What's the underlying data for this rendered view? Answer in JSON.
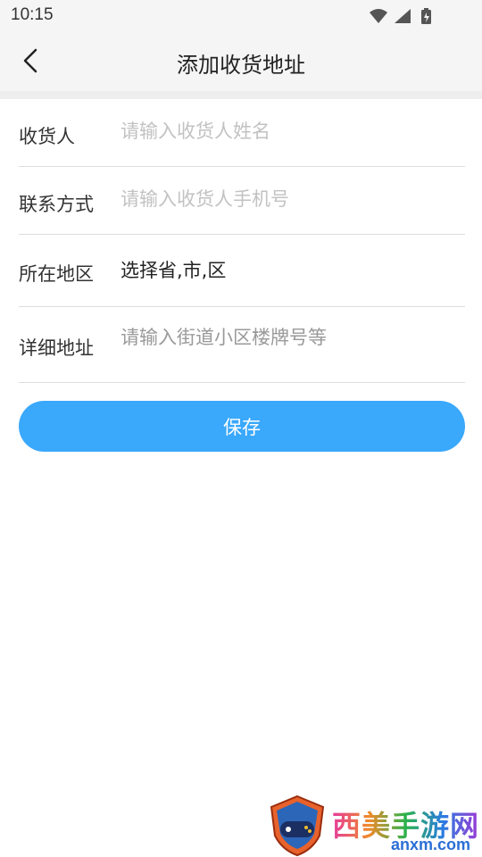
{
  "status_bar": {
    "time": "10:15",
    "icons": [
      "wifi-icon",
      "signal-icon",
      "battery-icon"
    ]
  },
  "header": {
    "title": "添加收货地址",
    "back_icon": "chevron-left-icon"
  },
  "form": {
    "recipient": {
      "label": "收货人",
      "placeholder": "请输入收货人姓名",
      "value": ""
    },
    "contact": {
      "label": "联系方式",
      "placeholder": "请输入收货人手机号",
      "value": ""
    },
    "region": {
      "label": "所在地区",
      "value": "选择省,市,区"
    },
    "address": {
      "label": "详细地址",
      "placeholder": "请输入街道小区楼牌号等",
      "value": ""
    }
  },
  "save_button": {
    "label": "保存"
  },
  "watermark": {
    "title": "西美手游网",
    "url": "anxm.com"
  },
  "colors": {
    "accent": "#3aa8fb",
    "header_bg": "#f5f5f5",
    "divider": "#dcdcdc",
    "placeholder": "#c2c2c2"
  }
}
